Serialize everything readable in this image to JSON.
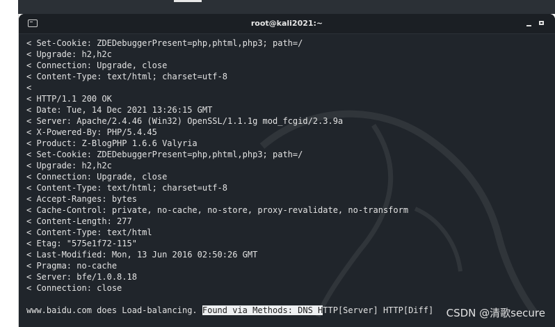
{
  "window": {
    "title": "root@kali2021:~"
  },
  "terminal": {
    "lines": [
      "< Set-Cookie: ZDEDebuggerPresent=php,phtml,php3; path=/",
      "< Upgrade: h2,h2c",
      "< Connection: Upgrade, close",
      "< Content-Type: text/html; charset=utf-8",
      "<",
      "< HTTP/1.1 200 OK",
      "< Date: Tue, 14 Dec 2021 13:26:15 GMT",
      "< Server: Apache/2.4.46 (Win32) OpenSSL/1.1.1g mod_fcgid/2.3.9a",
      "< X-Powered-By: PHP/5.4.45",
      "< Product: Z-BlogPHP 1.6.6 Valyria",
      "< Set-Cookie: ZDEDebuggerPresent=php,phtml,php3; path=/",
      "< Upgrade: h2,h2c",
      "< Connection: Upgrade, close",
      "< Content-Type: text/html; charset=utf-8",
      "< Accept-Ranges: bytes",
      "< Cache-Control: private, no-cache, no-store, proxy-revalidate, no-transform",
      "< Content-Length: 277",
      "< Content-Type: text/html",
      "< Etag: \"575e1f72-115\"",
      "< Last-Modified: Mon, 13 Jun 2016 02:50:26 GMT",
      "< Pragma: no-cache",
      "< Server: bfe/1.0.8.18",
      "< Connection: close"
    ],
    "final_line": {
      "prefix": "www.baidu.com does Load-balancing. ",
      "selected": "Found via Methods: DNS H",
      "suffix": "TTP[Server] HTTP[Diff]"
    }
  },
  "watermark": {
    "text": "CSDN @清歌secure"
  },
  "colors": {
    "terminal_bg": "#20252b",
    "titlebar_bg": "#1b1f24",
    "text": "#e3e3e3",
    "selection_bg": "#eef0f2"
  },
  "icons": {
    "terminal": "terminal-icon",
    "minimize": "minimize-icon",
    "maximize": "maximize-icon"
  }
}
